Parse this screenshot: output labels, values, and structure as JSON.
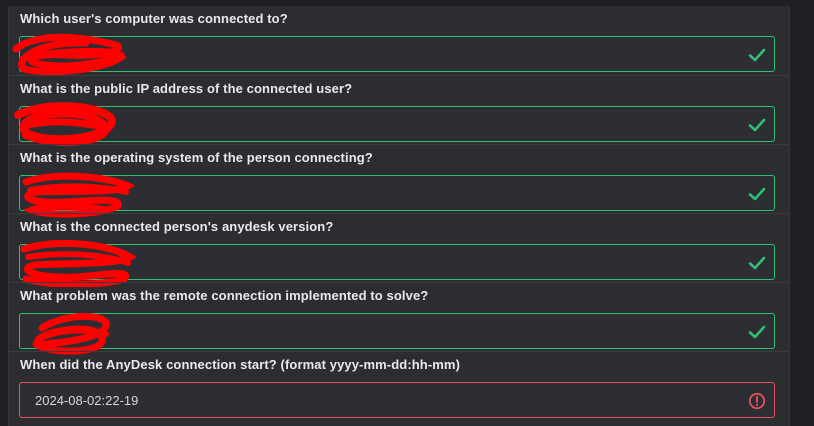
{
  "questions": [
    {
      "label": "Which user's computer was connected to?",
      "value": "",
      "status": "valid"
    },
    {
      "label": "What is the public IP address of the connected user?",
      "value": "",
      "status": "valid"
    },
    {
      "label": "What is the operating system of the person connecting?",
      "value": "",
      "status": "valid"
    },
    {
      "label": "What is the connected person's anydesk version?",
      "value": "",
      "status": "valid"
    },
    {
      "label": "What problem was the remote connection implemented to solve?",
      "value": "",
      "status": "valid"
    },
    {
      "label": "When did the AnyDesk connection start? (format yyyy-mm-dd:hh-mm)",
      "value": "2024-08-02:22-19",
      "status": "invalid"
    }
  ],
  "colors": {
    "valid": "#2fbf71",
    "invalid": "#e2525c",
    "redaction": "#ff0000"
  },
  "icons": {
    "valid": "check-icon",
    "invalid": "error-circle-icon"
  }
}
